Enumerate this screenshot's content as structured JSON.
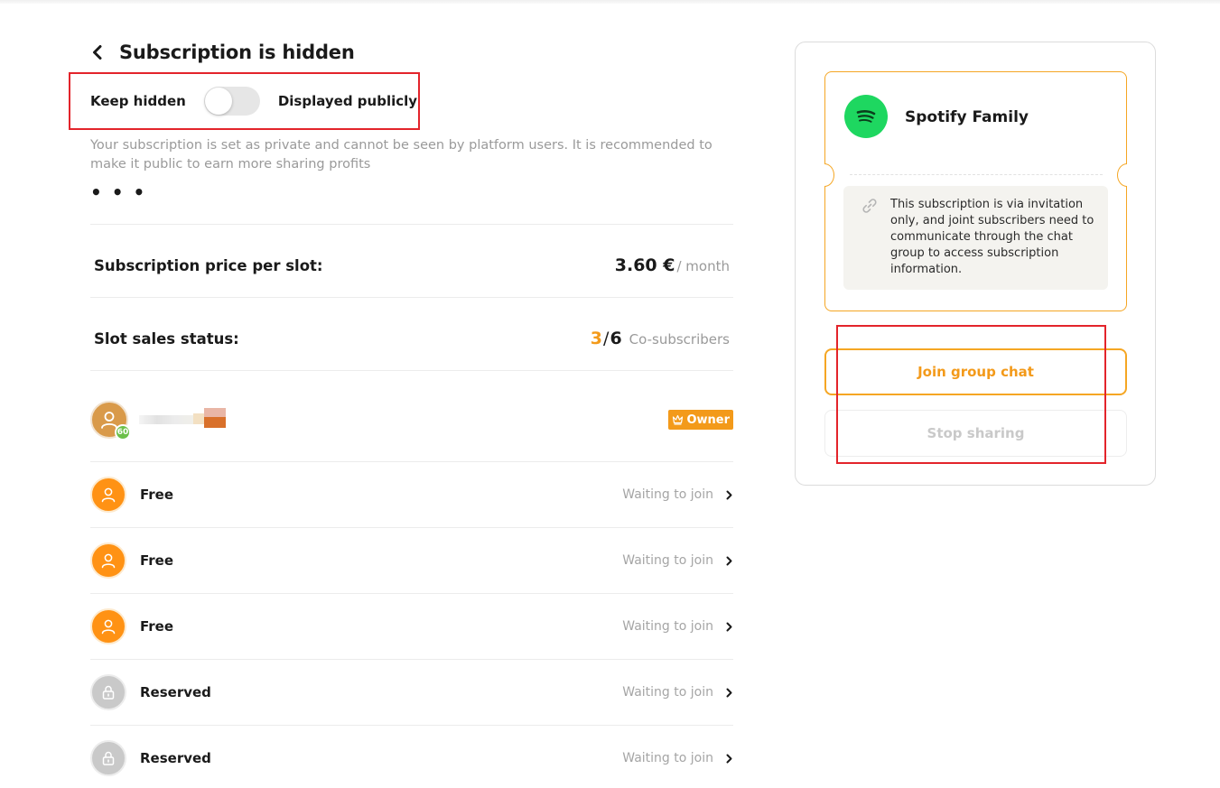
{
  "header": {
    "title": "Subscription is hidden",
    "back_icon": "chevron-left-icon"
  },
  "visibility": {
    "left_label": "Keep hidden",
    "right_label": "Displayed publicly",
    "toggle_state": "off",
    "description": "Your subscription is set as private and cannot be seen by platform users. It is recommended to make it public to earn more sharing profits",
    "more_label": "• • •"
  },
  "pricing": {
    "label": "Subscription price per slot:",
    "price": "3.60 €",
    "unit": "/ month"
  },
  "slots_status": {
    "label": "Slot sales status:",
    "sold": "3",
    "separator": "/",
    "total": "6",
    "suffix": "Co-subscribers"
  },
  "owner": {
    "level": "60",
    "badge": "Owner",
    "badge_icon": "crown-icon"
  },
  "slots": [
    {
      "label": "Free",
      "status": "Waiting to join",
      "kind": "free"
    },
    {
      "label": "Free",
      "status": "Waiting to join",
      "kind": "free"
    },
    {
      "label": "Free",
      "status": "Waiting to join",
      "kind": "free"
    },
    {
      "label": "Reserved",
      "status": "Waiting to join",
      "kind": "reserved"
    },
    {
      "label": "Reserved",
      "status": "Waiting to join",
      "kind": "reserved"
    }
  ],
  "card": {
    "plan_name": "Spotify Family",
    "logo": "spotify-logo",
    "note": "This subscription is via invitation only, and joint subscribers need to communicate through the chat group to access subscription information.",
    "join_label": "Join group chat",
    "stop_label": "Stop sharing"
  },
  "colors": {
    "accent": "#f39a1a",
    "spotify_green": "#1ed760",
    "highlight_red": "#e3242b"
  }
}
